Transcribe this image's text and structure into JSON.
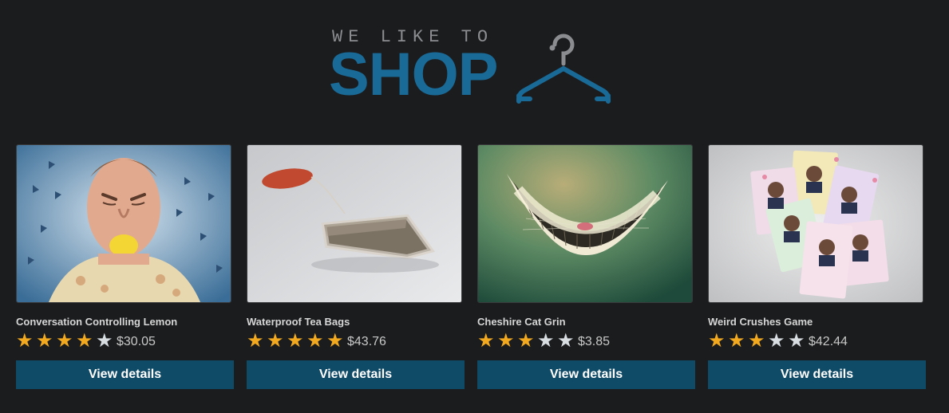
{
  "logo": {
    "tagline": "WE LIKE TO",
    "word": "SHOP",
    "brand_color": "#1a6a97",
    "icon": "hanger-icon"
  },
  "products": [
    {
      "title": "Conversation Controlling Lemon",
      "rating": 4,
      "max_rating": 5,
      "price": "$30.05",
      "button": "View details"
    },
    {
      "title": "Waterproof Tea Bags",
      "rating": 5,
      "max_rating": 5,
      "price": "$43.76",
      "button": "View details"
    },
    {
      "title": "Cheshire Cat Grin",
      "rating": 3,
      "max_rating": 5,
      "price": "$3.85",
      "button": "View details"
    },
    {
      "title": "Weird Crushes Game",
      "rating": 3,
      "max_rating": 5,
      "price": "$42.44",
      "button": "View details"
    }
  ],
  "colors": {
    "star_on": "#f2a91f",
    "star_off": "#d8dde2",
    "button_bg": "#0f4a67",
    "background": "#1b1c1e"
  }
}
